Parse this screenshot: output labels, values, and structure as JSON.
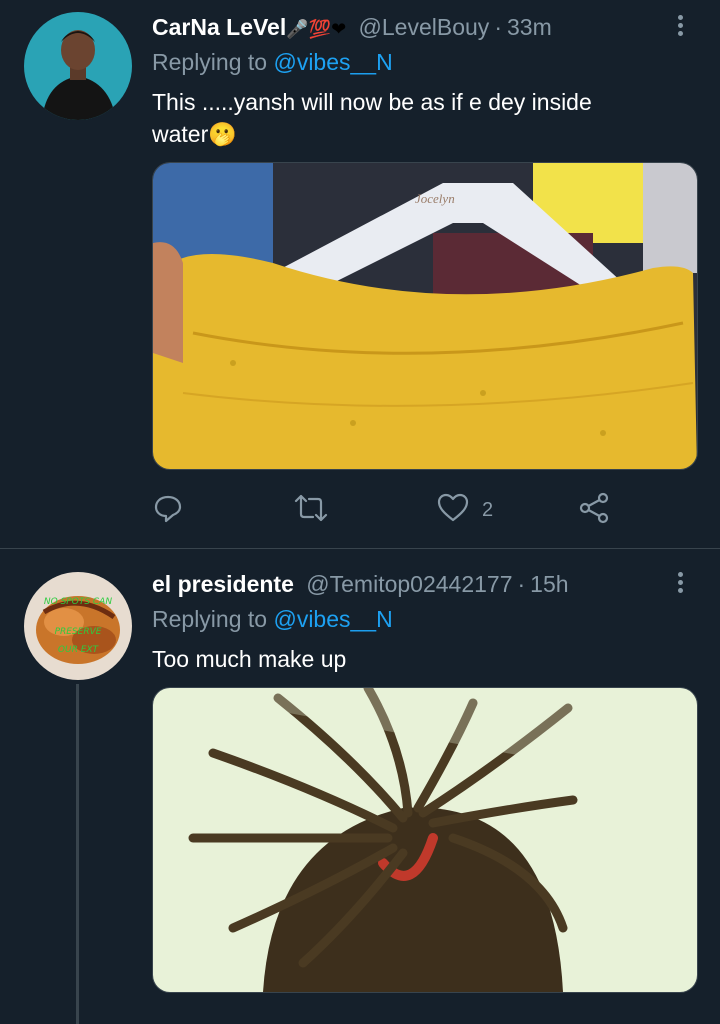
{
  "tweets": [
    {
      "name": "CarNa LeVel",
      "name_emojis": "🎤💯❤",
      "handle": "@LevelBouy",
      "separator": "·",
      "time": "33m",
      "replying_prefix": "Replying to",
      "replying_to": "@vibes__N",
      "text": "This .....yansh will now be as if e dey inside water🫢",
      "media_icon": "photo-yellow-top-on-hanger",
      "hanger_text": "Jocelyn",
      "actions": {
        "reply": {
          "icon": "reply-icon",
          "count": ""
        },
        "retweet": {
          "icon": "retweet-icon",
          "count": ""
        },
        "like": {
          "icon": "heart-icon",
          "count": "2"
        },
        "share": {
          "icon": "share-icon",
          "count": ""
        }
      }
    },
    {
      "name": "el presidente",
      "handle": "@Temitop02442177",
      "separator": "·",
      "time": "15h",
      "replying_prefix": "Replying to",
      "replying_to": "@vibes__N",
      "text": "Too much make up",
      "avatar_text": "NO SPOTS CAN PRESERVE OUR EXT",
      "media_icon": "photo-dreadlocks-head"
    }
  ],
  "colors": {
    "background": "#15202b",
    "text_primary": "#ffffff",
    "text_secondary": "#8899a6",
    "accent": "#1da1f2",
    "divider": "#38444d"
  }
}
